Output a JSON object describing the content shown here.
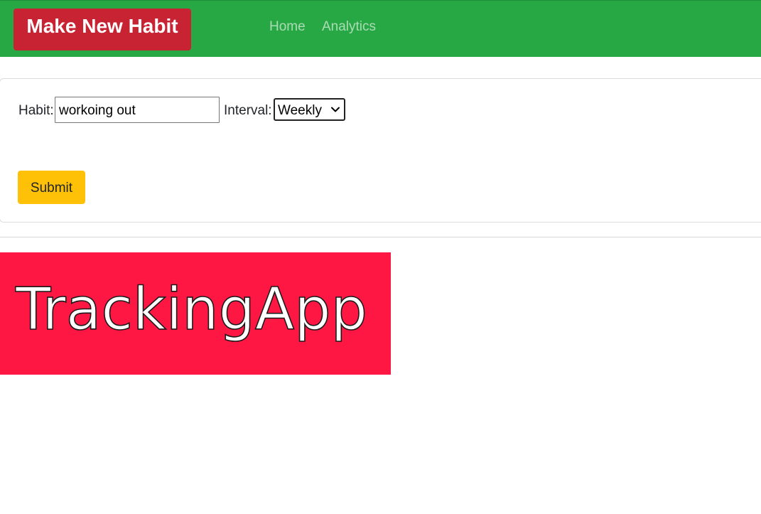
{
  "navbar": {
    "brand": "Make New Habit",
    "links": [
      {
        "label": "Home"
      },
      {
        "label": "Analytics"
      }
    ],
    "colors": {
      "background": "#28a745",
      "brand_background": "#c82333"
    }
  },
  "form": {
    "habit_label": "Habit:",
    "habit_value": "workoing out",
    "interval_label": "Interval:",
    "interval_selected": "Weekly",
    "submit_label": "Submit",
    "colors": {
      "submit_background": "#ffc107"
    }
  },
  "logo": {
    "text": "TrackingApp",
    "background": "#ff1744"
  }
}
